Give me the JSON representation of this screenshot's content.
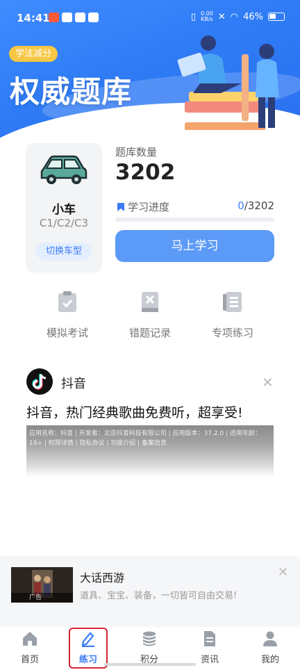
{
  "status_bar": {
    "time": "14:41",
    "speed_value": "0.00",
    "speed_unit": "KB/s",
    "battery": "46%"
  },
  "hero": {
    "badge": "学法减分",
    "title": "权威题库"
  },
  "vehicle": {
    "name": "小车",
    "types": "C1/C2/C3",
    "switch_label": "切换车型"
  },
  "bank": {
    "count_label": "题库数量",
    "count": "3202",
    "progress_label": "学习进度",
    "progress_current": "0",
    "progress_total": "/3202",
    "progress_fraction": 0,
    "start_button": "马上学习"
  },
  "quick_actions": [
    {
      "label": "模拟考试",
      "icon": "clipboard-check-icon"
    },
    {
      "label": "错题记录",
      "icon": "wrong-book-icon"
    },
    {
      "label": "专项练习",
      "icon": "notebook-icon"
    }
  ],
  "ad1": {
    "app_name": "抖音",
    "slogan": "抖音，热门经典歌曲免费听，超享受!",
    "info": "应用名称：抖音 | 开发者：北京抖音科技有限公司 | 应用版本：37.2.0 | 适用年龄：18+ | 权限详情 | 隐私协议 | 功能介绍 | 备案信息",
    "close": "✕"
  },
  "ad2": {
    "title": "大话西游",
    "description": "道具、宝宝、装备，一切皆可自由交易!",
    "thumb_label": "广告",
    "close": "✕"
  },
  "nav": [
    {
      "label": "首页",
      "icon": "home-icon"
    },
    {
      "label": "练习",
      "icon": "pencil-icon"
    },
    {
      "label": "积分",
      "icon": "coins-icon"
    },
    {
      "label": "资讯",
      "icon": "document-icon"
    },
    {
      "label": "我的",
      "icon": "user-icon"
    }
  ],
  "colors": {
    "primary": "#3b7bf5",
    "button": "#5b9af7",
    "badge": "#f7c744",
    "highlight": "#d6232b"
  }
}
